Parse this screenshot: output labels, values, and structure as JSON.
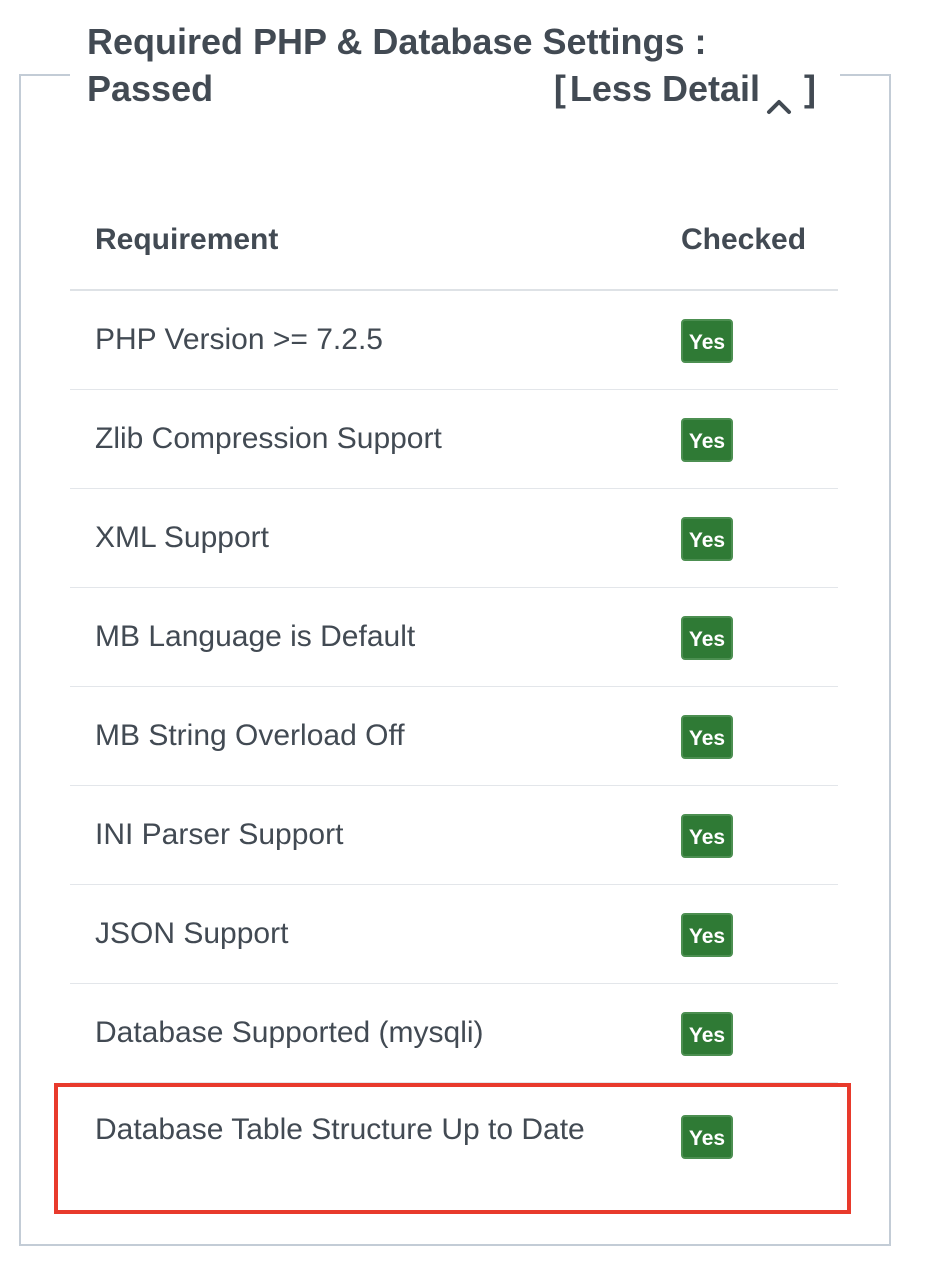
{
  "panel": {
    "title_line1": "Required PHP & Database Settings :",
    "status": "Passed",
    "toggle": {
      "open_bracket": "[",
      "label": "Less Detail",
      "icon": "chevron-up-icon",
      "close_bracket": "]"
    }
  },
  "table": {
    "headers": [
      "Requirement",
      "Checked"
    ],
    "rows": [
      {
        "requirement": "PHP Version >= 7.2.5",
        "checked": "Yes"
      },
      {
        "requirement": "Zlib Compression Support",
        "checked": "Yes"
      },
      {
        "requirement": "XML Support",
        "checked": "Yes"
      },
      {
        "requirement": "MB Language is Default",
        "checked": "Yes"
      },
      {
        "requirement": "MB String Overload Off",
        "checked": "Yes"
      },
      {
        "requirement": "INI Parser Support",
        "checked": "Yes"
      },
      {
        "requirement": "JSON Support",
        "checked": "Yes"
      },
      {
        "requirement": "Database Supported (mysqli)",
        "checked": "Yes"
      },
      {
        "requirement": "Database Table Structure Up to Date",
        "checked": "Yes"
      }
    ]
  },
  "colors": {
    "badge_success": "#2f7a35",
    "highlight": "#e83a2c",
    "border": "#c3ccd6"
  }
}
